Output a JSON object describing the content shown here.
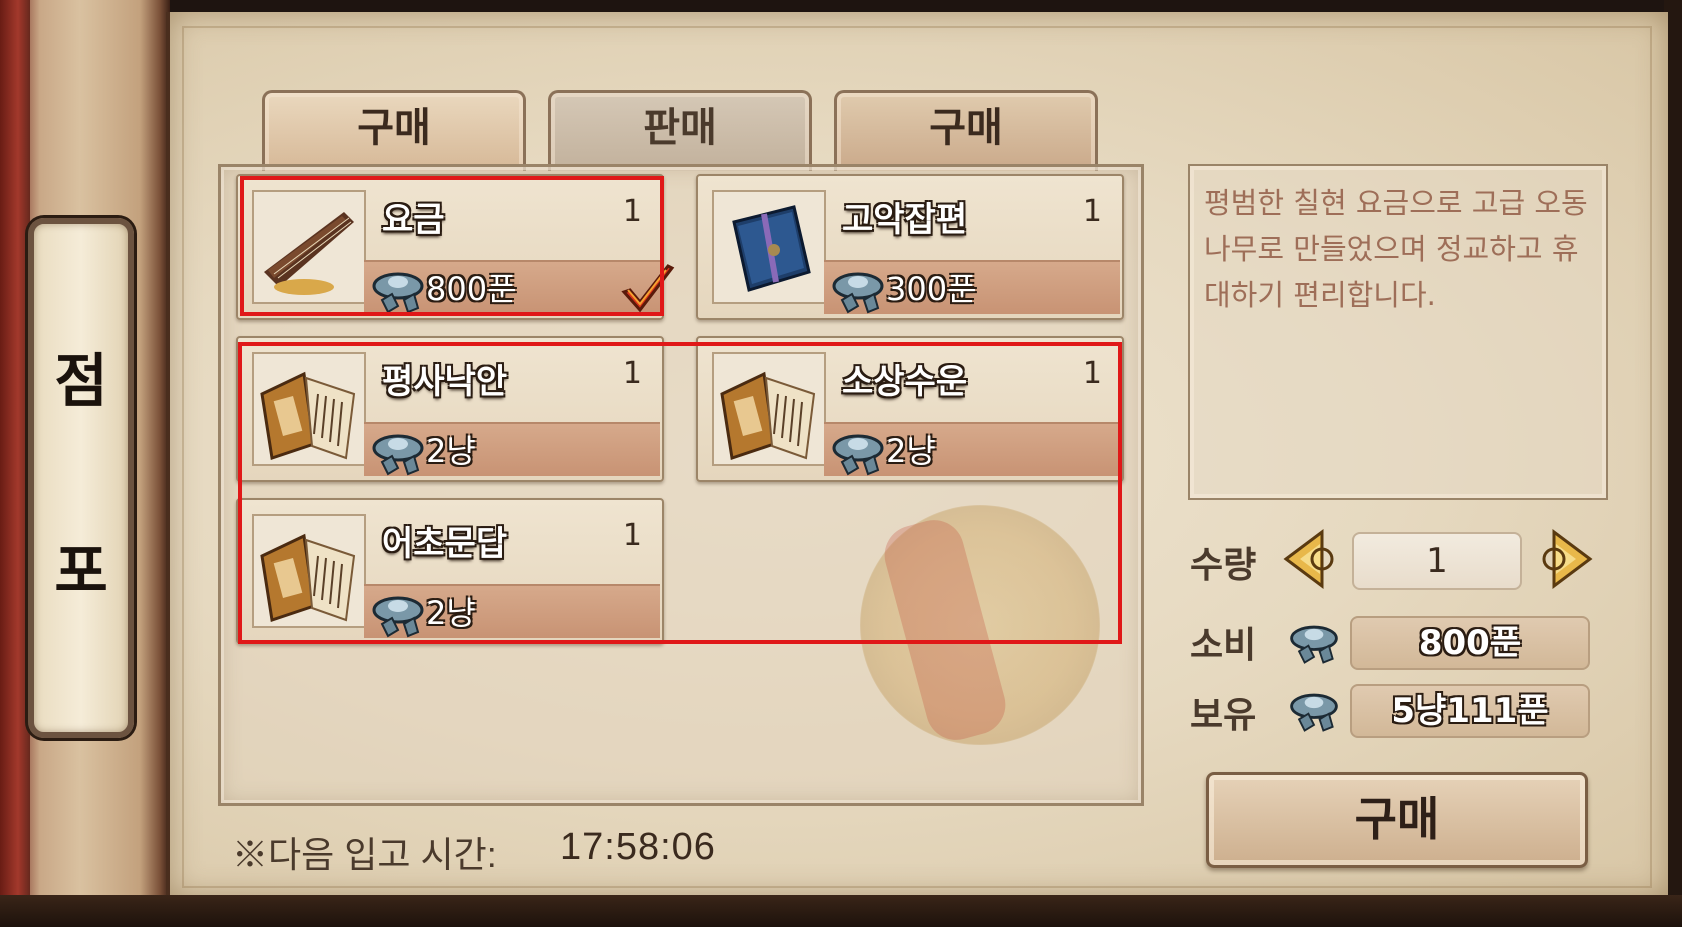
{
  "side": {
    "title_top": "점",
    "title_bottom": "포"
  },
  "tabs": [
    {
      "label": "구매",
      "state": "active"
    },
    {
      "label": "판매",
      "state": "inactive"
    },
    {
      "label": "구매",
      "state": "normal"
    }
  ],
  "items": [
    {
      "name": "요금",
      "qty": "1",
      "price": "800푼",
      "icon": "zither-icon",
      "selected": true
    },
    {
      "name": "고악잡편",
      "qty": "1",
      "price": "300푼",
      "icon": "blue-book-icon",
      "selected": false
    },
    {
      "name": "평사낙안",
      "qty": "1",
      "price": "2냥",
      "icon": "scroll-book-icon",
      "selected": false
    },
    {
      "name": "소상수운",
      "qty": "1",
      "price": "2냥",
      "icon": "scroll-book-icon",
      "selected": false
    },
    {
      "name": "어초문답",
      "qty": "1",
      "price": "2냥",
      "icon": "scroll-book-icon",
      "selected": false
    }
  ],
  "restock": {
    "label": "※다음 입고 시간:",
    "time": "17:58:06"
  },
  "description": "평범한 칠현 요금으로 고급 오동나무로 만들었으며 정교하고 휴대하기 편리합니다.",
  "purchase": {
    "quantity_label": "수량",
    "quantity_value": "1",
    "cost_label": "소비",
    "cost_value": "800푼",
    "owned_label": "보유",
    "owned_value": "5냥111푼",
    "buy_label": "구매"
  },
  "colors": {
    "highlight": "#e01818",
    "price_bar": "#c89374",
    "desc_text": "#9e6e58"
  }
}
